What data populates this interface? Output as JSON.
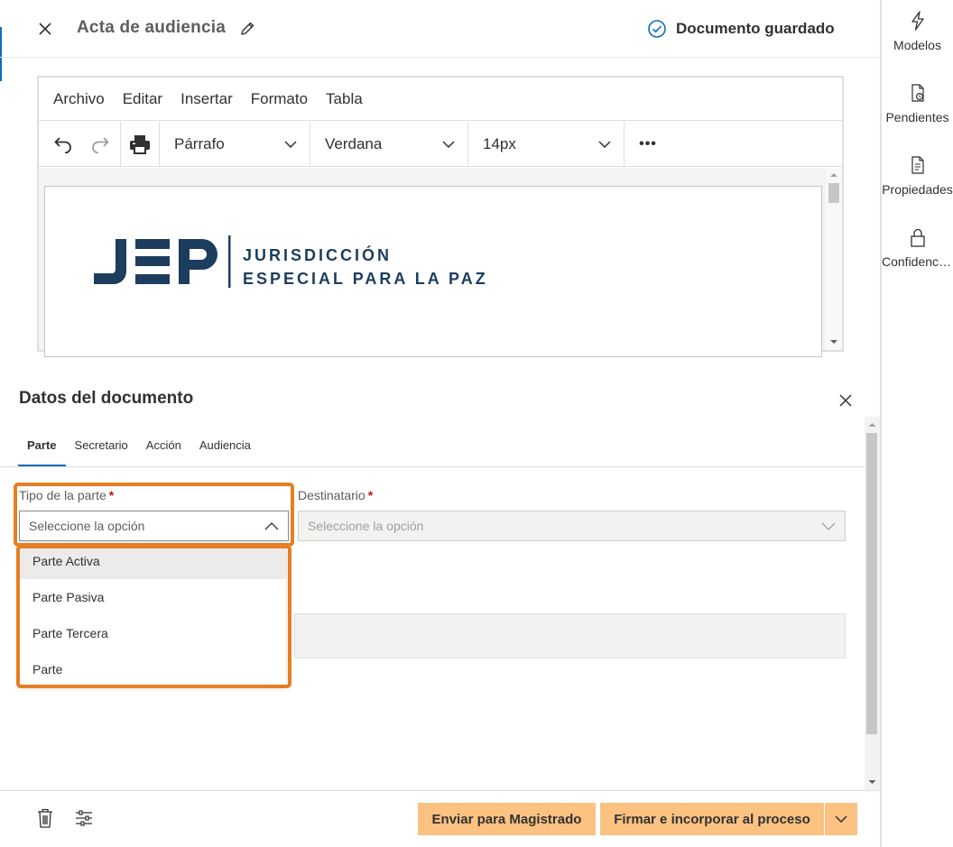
{
  "header": {
    "title": "Acta de audiencia",
    "saved_status": "Documento guardado"
  },
  "right_rail": {
    "items": [
      {
        "label": "Modelos",
        "icon": "lightning-icon"
      },
      {
        "label": "Pendientes",
        "icon": "pending-document-icon"
      },
      {
        "label": "Propiedades",
        "icon": "properties-document-icon"
      },
      {
        "label": "Confidencialidad",
        "icon": "lock-icon"
      }
    ]
  },
  "editor": {
    "menu": [
      "Archivo",
      "Editar",
      "Insertar",
      "Formato",
      "Tabla"
    ],
    "toolbar": {
      "block_format": "Párrafo",
      "font_family": "Verdana",
      "font_size": "14px",
      "more": "•••"
    },
    "logo": {
      "mark": "JEP",
      "line1": "JURISDICCIÓN",
      "line2": "ESPECIAL PARA LA PAZ",
      "color": "#1c3d5e"
    }
  },
  "panel": {
    "title": "Datos del documento",
    "tabs": [
      "Parte",
      "Secretario",
      "Acción",
      "Audiencia"
    ],
    "active_tab": "Parte",
    "tipo_parte": {
      "label": "Tipo de la parte",
      "required_mark": "*",
      "placeholder": "Seleccione la opción",
      "options": [
        "Parte Activa",
        "Parte Pasiva",
        "Parte Tercera",
        "Parte"
      ]
    },
    "destinatario": {
      "label": "Destinatario",
      "required_mark": "*",
      "placeholder": "Seleccione la opción"
    }
  },
  "footer": {
    "send_label": "Enviar para Magistrado",
    "sign_label": "Firmar e incorporar al proceso"
  },
  "colors": {
    "accent": "#0f6cbd",
    "highlight": "#e67e22",
    "primary_button": "#fbc281",
    "required": "#c50f1f"
  }
}
